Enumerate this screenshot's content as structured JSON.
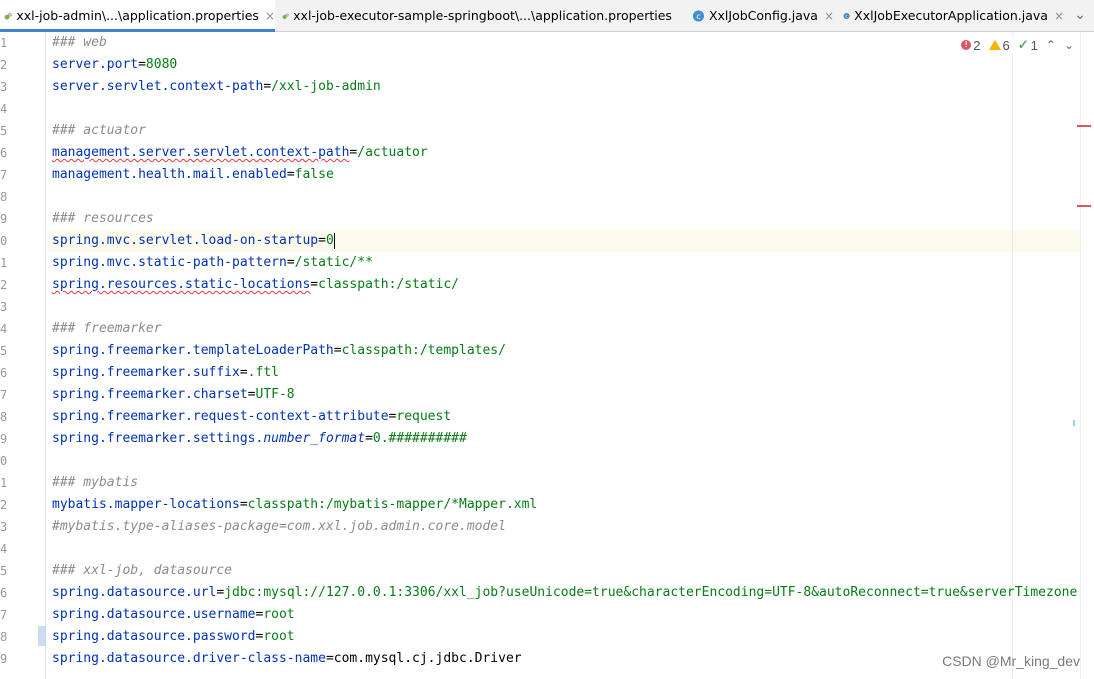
{
  "tabs": [
    {
      "label": "xxl-job-admin\\...\\application.properties",
      "active": true,
      "icon": "properties-file-icon",
      "close": "×"
    },
    {
      "label": "xxl-job-executor-sample-springboot\\...\\application.properties",
      "active": false,
      "icon": "properties-file-icon",
      "close": "×"
    },
    {
      "label": "XxlJobConfig.java",
      "active": false,
      "icon": "java-class-icon",
      "close": "×"
    },
    {
      "label": "XxlJobExecutorApplication.java",
      "active": false,
      "icon": "java-class-icon",
      "close": "×"
    }
  ],
  "tab_overflow_icon": "chevron-down-icon",
  "inspections": {
    "errors": "2",
    "warnings": "6",
    "ok": "1"
  },
  "line_numbers": [
    "1",
    "2",
    "3",
    "4",
    "5",
    "6",
    "7",
    "8",
    "9",
    "0",
    "1",
    "2",
    "3",
    "4",
    "5",
    "6",
    "7",
    "8",
    "9",
    "0",
    "1",
    "2",
    "3",
    "4",
    "5",
    "6",
    "7",
    "8",
    "9"
  ],
  "code": {
    "l1_comment": "### web",
    "l2_key": "server.port",
    "l2_eq": "=",
    "l2_val": "8080",
    "l3_key": "server.servlet.context-path",
    "l3_eq": "=",
    "l3_val": "/xxl-job-admin",
    "l5_comment": "### actuator",
    "l6_key": "management.server.servlet.context-path",
    "l6_eq": "=",
    "l6_val": "/actuator",
    "l7_key": "management.health.mail.enabled",
    "l7_eq": "=",
    "l7_val": "false",
    "l9_comment": "### resources",
    "l10_key": "spring.mvc.servlet.load-on-startup",
    "l10_eq": "=",
    "l10_val": "0",
    "l11_key": "spring.mvc.static-path-pattern",
    "l11_eq": "=",
    "l11_val": "/static/**",
    "l12_key_a": "spring",
    "l12_key_b": ".resources.static-locations",
    "l12_eq": "=",
    "l12_val": "classpath:/static/",
    "l14_comment": "### freemarker",
    "l15_key": "spring.freemarker.templateLoaderPath",
    "l15_eq": "=",
    "l15_val": "classpath:/templates/",
    "l16_key": "spring.freemarker.suffix",
    "l16_eq": "=",
    "l16_val": ".ftl",
    "l17_key": "spring.freemarker.charset",
    "l17_eq": "=",
    "l17_val": "UTF-8",
    "l18_key": "spring.freemarker.request-context-attribute",
    "l18_eq": "=",
    "l18_val": "request",
    "l19_key": "spring.freemarker.settings.",
    "l19_key_it": "number_format",
    "l19_eq": "=",
    "l19_val": "0.##########",
    "l21_comment": "### mybatis",
    "l22_key": "mybatis.mapper-locations",
    "l22_eq": "=",
    "l22_val": "classpath:/mybatis-mapper/*Mapper.xml",
    "l23_comment": "#mybatis.type-aliases-package=com.xxl.job.admin.core.model",
    "l25_comment": "### xxl-job, datasource",
    "l26_key": "spring.datasource.url",
    "l26_eq": "=",
    "l26_val": "jdbc:mysql://127.0.0.1:3306/xxl_job?useUnicode=true&characterEncoding=UTF-8&autoReconnect=true&serverTimezone",
    "l27_key": "spring.datasource.username",
    "l27_eq": "=",
    "l27_val": "root",
    "l28_key": "spring.datasource.password",
    "l28_eq": "=",
    "l28_val": "root",
    "l29_key": "spring.datasource.driver-class-name",
    "l29_eq": "=",
    "l29_val": "com.mysql.cj.jdbc.Driver"
  },
  "colors": {
    "key": "#0033b3",
    "value": "#067d17",
    "comment": "#8c8c8c",
    "tab_accent": "#4083c9",
    "error": "#db5860",
    "warning": "#f4b400"
  },
  "watermark": "CSDN @Mr_king_dev"
}
